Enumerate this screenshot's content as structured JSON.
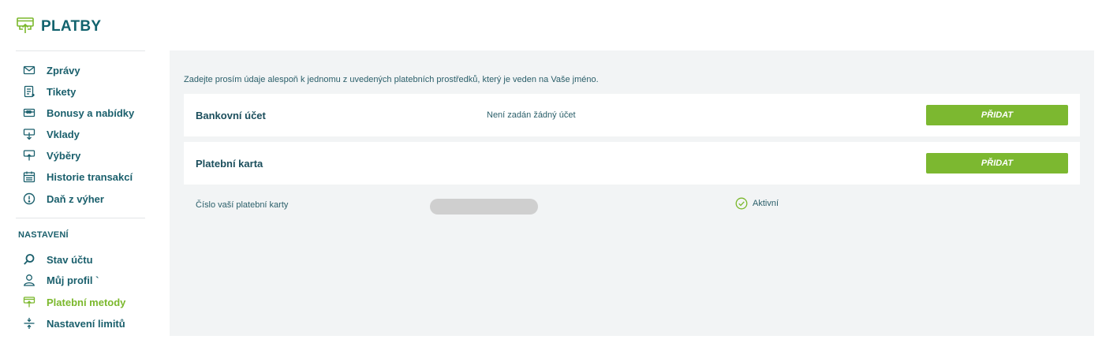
{
  "header": {
    "title": "PLATBY",
    "icon": "payments-icon"
  },
  "sidebar": {
    "items": [
      {
        "label": "Zprávy",
        "icon": "envelope-icon"
      },
      {
        "label": "Tikety",
        "icon": "ticket-icon"
      },
      {
        "label": "Bonusy a nabídky",
        "icon": "gift-card-icon"
      },
      {
        "label": "Vklady",
        "icon": "deposit-icon"
      },
      {
        "label": "Výběry",
        "icon": "withdrawal-icon"
      },
      {
        "label": "Historie transakcí",
        "icon": "calendar-icon"
      },
      {
        "label": "Daň z výher",
        "icon": "exclamation-circle-icon"
      }
    ],
    "settings_label": "NASTAVENÍ",
    "settings_items": [
      {
        "label": "Stav účtu",
        "icon": "search-icon"
      },
      {
        "label": "Můj profil `",
        "icon": "user-icon"
      },
      {
        "label": "Platební metody",
        "icon": "payment-method-icon",
        "active": true
      },
      {
        "label": "Nastavení limitů",
        "icon": "limits-icon"
      }
    ]
  },
  "main": {
    "intro": "Zadejte prosím údaje alespoň k jednomu z uvedených platebních prostředků, který je veden na Vaše jméno.",
    "bank": {
      "label": "Bankovní účet",
      "value": "Není zadán žádný účet",
      "button": "PŘIDAT"
    },
    "card": {
      "label": "Platební karta",
      "button": "PŘIDAT"
    },
    "card_detail": {
      "label": "Číslo vaší platební karty",
      "status": "Aktivní",
      "status_icon": "check-circle-icon"
    }
  },
  "colors": {
    "accent": "#7cb830",
    "text": "#1a5f6c",
    "panel": "#f2f4f5"
  }
}
